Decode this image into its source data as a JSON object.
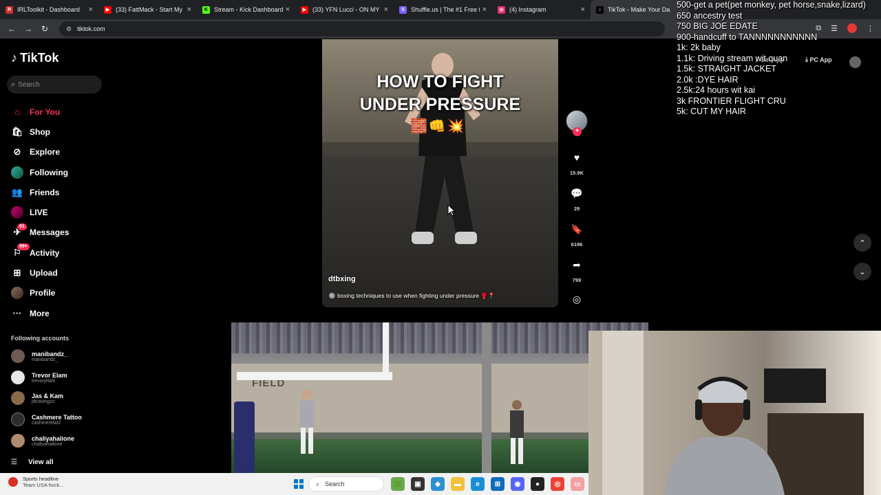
{
  "browser": {
    "tabs": [
      {
        "title": "IRLToolkit - Dashboard",
        "color": "#d32f2f",
        "glyph": "R"
      },
      {
        "title": "(33) FattMack - Start My D",
        "color": "#ff0000",
        "glyph": "▶"
      },
      {
        "title": "Stream - Kick Dashboard",
        "color": "#53fc18",
        "glyph": "K"
      },
      {
        "title": "(33) YFN Lucci - ON MY M",
        "color": "#ff0000",
        "glyph": "▶"
      },
      {
        "title": "Shuffle.us | The #1 Free to",
        "color": "#7b61ff",
        "glyph": "S"
      },
      {
        "title": "(4) Instagram",
        "color": "#e1306c",
        "glyph": "◎"
      },
      {
        "title": "TikTok - Make Your Da",
        "color": "#000000",
        "glyph": "♪"
      }
    ],
    "url": "tiktok.com"
  },
  "stream_overlay": {
    "goals": [
      "500-get a pet(pet monkey, pet horse,snake,lizard)",
      "650 ancestry test",
      "750 BIG JOE EDATE",
      "900-handcuff to TANNNNNNNNNNN",
      "1k: 2k baby",
      "1.1k: Driving stream wit quan",
      "1.5k: STRAIGHT JACKET",
      "2.0k :DYE HAIR",
      "2.5k:24 hours wit kai",
      "3k FRONTIER FLIGHT CRU",
      "5k: CUT MY HAIR"
    ]
  },
  "tiktok": {
    "logo": "TikTok",
    "search_placeholder": "Search",
    "nav": [
      {
        "label": "For You",
        "icon": "home-icon",
        "glyph": "⌂",
        "active": true
      },
      {
        "label": "Shop",
        "icon": "shop-icon",
        "glyph": "🛍"
      },
      {
        "label": "Explore",
        "icon": "compass-icon",
        "glyph": "⊘"
      },
      {
        "label": "Following",
        "icon": "avatar-icon",
        "glyph": ""
      },
      {
        "label": "Friends",
        "icon": "friends-icon",
        "glyph": "👥"
      },
      {
        "label": "LIVE",
        "icon": "avatar-icon",
        "glyph": ""
      },
      {
        "label": "Messages",
        "icon": "messages-icon",
        "glyph": "✈",
        "badge": "61"
      },
      {
        "label": "Activity",
        "icon": "activity-icon",
        "glyph": "⚐",
        "badge": "99+"
      },
      {
        "label": "Upload",
        "icon": "upload-icon",
        "glyph": "⊞"
      },
      {
        "label": "Profile",
        "icon": "avatar-icon",
        "glyph": ""
      },
      {
        "label": "More",
        "icon": "more-icon",
        "glyph": "···"
      }
    ],
    "following_heading": "Following accounts",
    "following": [
      {
        "name": "manibandz_",
        "handle": "manibandz_"
      },
      {
        "name": "Trevor Elam",
        "handle": "trevorjelam"
      },
      {
        "name": "Jas & Kam",
        "handle": "jtkravingzz"
      },
      {
        "name": "Cashmere Tattoo",
        "handle": "cashmeretat2"
      },
      {
        "name": "chaliyahalione",
        "handle": "chaliyahalione"
      }
    ],
    "view_all": "View all",
    "header_right": {
      "get_app": "Get App",
      "pc_app": "PC App"
    },
    "video": {
      "overlay_title_line1": "HOW TO FIGHT",
      "overlay_title_line2": "UNDER PRESSURE",
      "author": "dtbxing",
      "caption": "boxing techniques to use when fighting under pressure",
      "likes": "15.9K",
      "comments": "29",
      "saves": "6196",
      "shares": "799"
    },
    "video2": {
      "painted_text": "FIELD"
    }
  },
  "taskbar": {
    "news_line1": "Sports headline",
    "news_line2": "Team USA hock...",
    "search_placeholder": "Search"
  }
}
